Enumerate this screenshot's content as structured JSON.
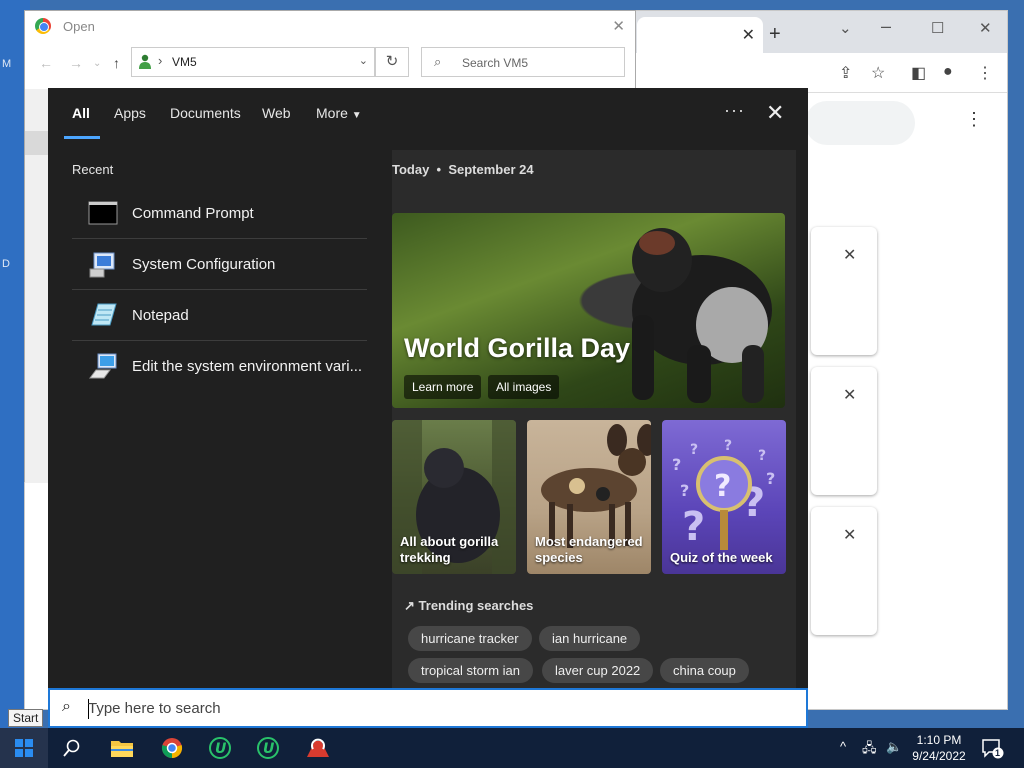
{
  "dialog": {
    "title": "Open",
    "address": "VM5",
    "search_placeholder": "Search VM5"
  },
  "search_panel": {
    "tabs": [
      "All",
      "Apps",
      "Documents",
      "Web",
      "More"
    ],
    "recent_title": "Recent",
    "recent": [
      {
        "label": "Command Prompt",
        "icon": "cmd-icon"
      },
      {
        "label": "System Configuration",
        "icon": "msconfig-icon"
      },
      {
        "label": "Notepad",
        "icon": "notepad-icon"
      },
      {
        "label": "Edit the system environment vari...",
        "icon": "system-properties-icon"
      }
    ],
    "today_label": "Today",
    "date": "September 24",
    "hero": {
      "title": "World Gorilla Day",
      "learn_more": "Learn more",
      "all_images": "All images"
    },
    "tiles": [
      {
        "label": "All about gorilla trekking"
      },
      {
        "label": "Most endangered species"
      },
      {
        "label": "Quiz of the week"
      }
    ],
    "trending_title": "Trending searches",
    "trending": [
      "hurricane tracker",
      "ian hurricane",
      "tropical storm ian",
      "laver cup 2022",
      "china coup"
    ]
  },
  "searchbox": {
    "placeholder": "Type here to search"
  },
  "start_tooltip": "Start",
  "taskbar": {
    "time": "1:10 PM",
    "date": "9/24/2022",
    "notification_count": "1"
  },
  "desktop": {
    "left_labels": [
      "M",
      "D"
    ]
  },
  "colors": {
    "accent": "#4ca6ff",
    "panel_bg": "#202020",
    "taskbar_bg": "#10203a"
  }
}
